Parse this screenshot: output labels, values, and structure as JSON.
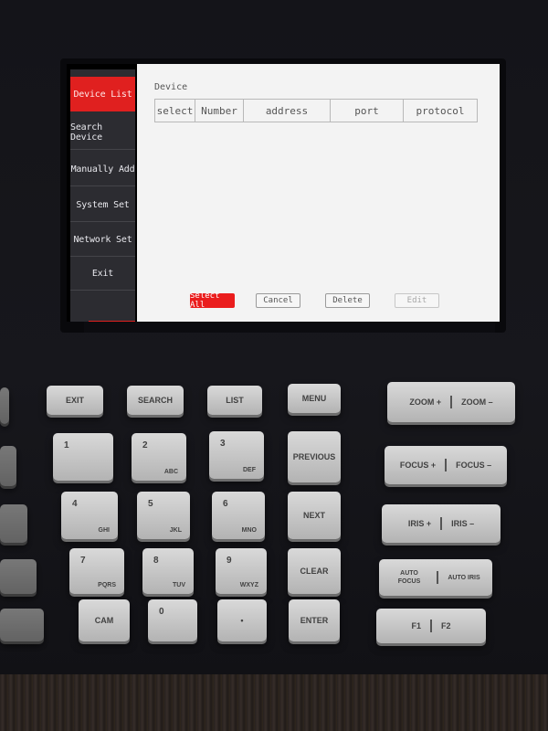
{
  "sidebar": {
    "items": [
      {
        "label": "Device List",
        "active": true
      },
      {
        "label": "Search Device",
        "active": false
      },
      {
        "label": "Manually Add",
        "active": false
      },
      {
        "label": "System Set",
        "active": false
      },
      {
        "label": "Network Set",
        "active": false
      },
      {
        "label": "Exit",
        "active": false
      }
    ]
  },
  "main": {
    "title": "Device",
    "table": {
      "columns": [
        "select",
        "Number",
        "address",
        "port",
        "protocol"
      ],
      "rows": []
    },
    "buttons": {
      "select_all": "Select All",
      "cancel": "Cancel",
      "delete": "Delete",
      "edit": "Edit"
    }
  },
  "keypad": {
    "exit": "EXIT",
    "search": "SEARCH",
    "list": "LIST",
    "menu": "MENU",
    "zoom_plus": "ZOOM +",
    "zoom_minus": "ZOOM –",
    "previous": "PREVIOUS",
    "focus_plus": "FOCUS +",
    "focus_minus": "FOCUS –",
    "next": "NEXT",
    "iris_plus": "IRIS +",
    "iris_minus": "IRIS –",
    "clear": "CLEAR",
    "auto_focus": "AUTO FOCUS",
    "auto_iris": "AUTO IRIS",
    "enter": "ENTER",
    "f1": "F1",
    "f2": "F2",
    "cam": "CAM",
    "dot": "•",
    "digits": [
      {
        "num": "1",
        "sub": ""
      },
      {
        "num": "2",
        "sub": "ABC"
      },
      {
        "num": "3",
        "sub": "DEF"
      },
      {
        "num": "4",
        "sub": "GHI"
      },
      {
        "num": "5",
        "sub": "JKL"
      },
      {
        "num": "6",
        "sub": "MNO"
      },
      {
        "num": "7",
        "sub": "PQRS"
      },
      {
        "num": "8",
        "sub": "TUV"
      },
      {
        "num": "9",
        "sub": "WXYZ"
      },
      {
        "num": "0",
        "sub": ""
      }
    ]
  },
  "colors": {
    "accent": "#e0201f",
    "sidebar_bg": "#2c2c31",
    "panel_bg": "#f3f3f3"
  }
}
